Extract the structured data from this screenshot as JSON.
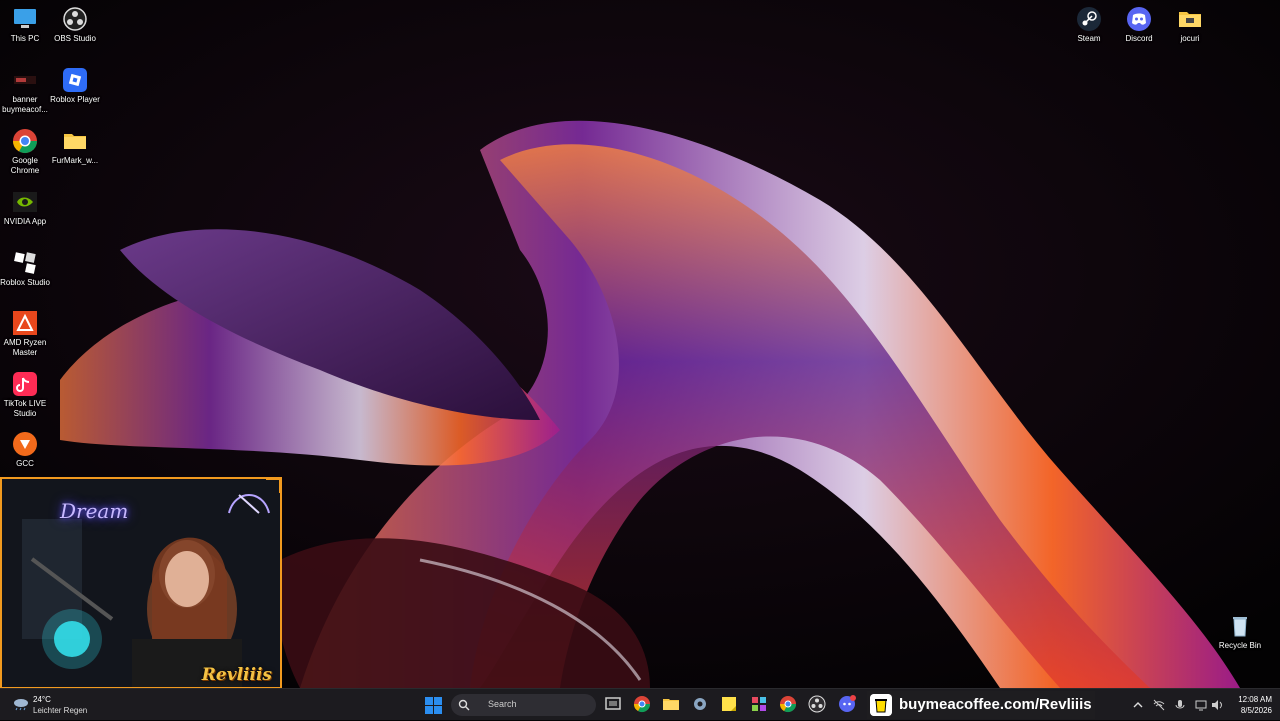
{
  "desktop": {
    "icons_left": [
      {
        "label": "This PC",
        "icon": "this-pc-icon"
      },
      {
        "label": "OBS Studio",
        "icon": "obs-studio-icon"
      },
      {
        "label": "banner buymeacof...",
        "icon": "banner-file-icon"
      },
      {
        "label": "Roblox Player",
        "icon": "roblox-player-icon"
      },
      {
        "label": "Google Chrome",
        "icon": "google-chrome-icon"
      },
      {
        "label": "FurMark_w...",
        "icon": "folder-icon"
      },
      {
        "label": "NVIDIA App",
        "icon": "nvidia-icon"
      },
      {
        "label": "Roblox Studio",
        "icon": "roblox-studio-icon"
      },
      {
        "label": "AMD Ryzen Master",
        "icon": "amd-ryzen-master-icon"
      },
      {
        "label": "TikTok LIVE Studio",
        "icon": "tiktok-live-icon"
      },
      {
        "label": "GCC",
        "icon": "gcc-icon"
      }
    ],
    "icons_right": [
      {
        "label": "Steam",
        "icon": "steam-icon"
      },
      {
        "label": "Discord",
        "icon": "discord-icon"
      },
      {
        "label": "jocuri",
        "icon": "folder-icon"
      }
    ],
    "recycle_bin": {
      "label": "Recycle Bin",
      "icon": "recycle-bin-icon"
    }
  },
  "webcam": {
    "neon_sign": "Dream",
    "streamer_name": "Revliiis",
    "accent": "#f29a1f"
  },
  "taskbar": {
    "weather": {
      "temp": "24°C",
      "condition": "Leichter Regen"
    },
    "search_placeholder": "Search",
    "apps": [
      "task-view-icon",
      "chrome-icon",
      "file-explorer-icon",
      "settings-icon",
      "sticky-notes-icon",
      "app-grid-icon",
      "chrome-icon",
      "obs-icon",
      "discord-icon"
    ],
    "overlay_url": "buymeacoffee.com/Revliiis",
    "clock": {
      "time": "12:08 AM",
      "date": "8/5/2026"
    }
  },
  "colors": {
    "taskbar": "#1c1b1f",
    "accent_blue": "#0078d4"
  }
}
